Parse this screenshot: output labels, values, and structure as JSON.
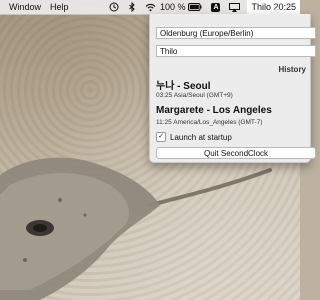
{
  "menubar": {
    "menus": [
      "Window",
      "Help"
    ],
    "battery_text": "100 %",
    "input_source": "A",
    "clock_label": "Thilo 20:25",
    "icons": [
      "history-icon",
      "bluetooth-icon",
      "wifi-icon",
      "battery-icon",
      "input-source-icon",
      "airplay-icon"
    ]
  },
  "panel": {
    "timezone_value": "Oldenburg (Europe/Berlin)",
    "name_value": "Thilo",
    "history_label": "History",
    "entries": [
      {
        "title": "누나 - Seoul",
        "subtitle": "03:25 Asia/Seoul (GMT+9)"
      },
      {
        "title": "Margarete - Los Angeles",
        "subtitle": "11:25 America/Los_Angeles (GMT-7)"
      }
    ],
    "launch_label": "Launch at startup",
    "launch_checked": true,
    "quit_label": "Quit SecondClock"
  },
  "colors": {
    "menubar_bg": "#ebebeb",
    "panel_bg": "#ececec"
  }
}
